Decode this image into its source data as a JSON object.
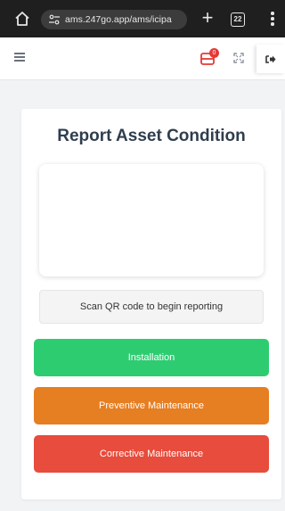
{
  "browser": {
    "url": "ams.247go.app/ams/icipa",
    "tab_count": "22"
  },
  "header": {
    "notification_count": "0"
  },
  "card": {
    "title": "Report Asset Condition",
    "scan_status": "Scan QR code to begin reporting"
  },
  "actions": [
    {
      "label": "Installation",
      "color": "#2ecc71"
    },
    {
      "label": "Preventive Maintenance",
      "color": "#e67e22"
    },
    {
      "label": "Corrective Maintenance",
      "color": "#e74c3c"
    }
  ],
  "icons": {
    "home": "home-icon",
    "site_settings": "tune-icon",
    "new_tab": "plus-icon",
    "tabs": "tab-switcher-icon",
    "menu": "more-vertical-icon",
    "hamburger": "hamburger-icon",
    "notifications": "inbox-icon",
    "fullscreen": "expand-icon",
    "logout": "sign-out-icon"
  }
}
